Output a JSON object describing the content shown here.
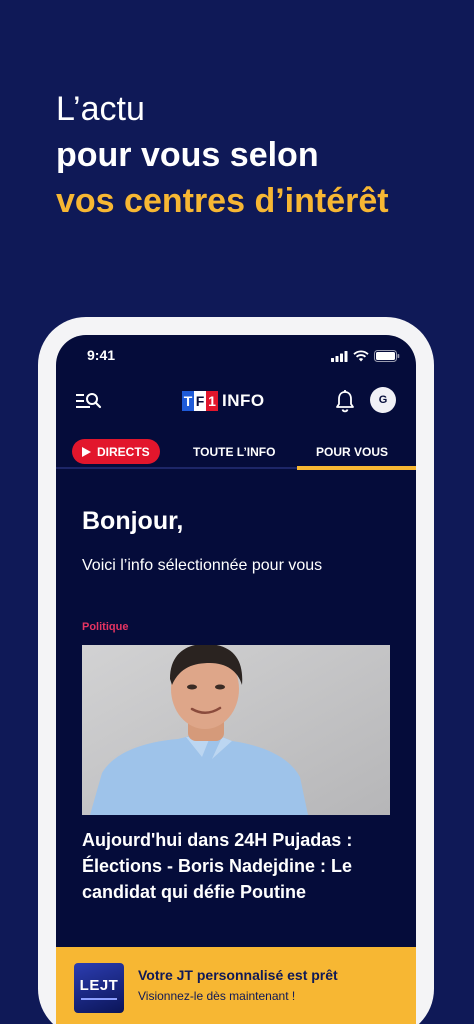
{
  "promo": {
    "line1": "L’actu",
    "line2": "pour vous selon",
    "line3": "vos centres d’intérêt"
  },
  "status_bar": {
    "time": "9:41"
  },
  "app_bar": {
    "logo_letters": [
      "T",
      "F",
      "1"
    ],
    "logo_text": "INFO",
    "avatar_initial": "G",
    "icons": [
      "menu-search-icon",
      "bell-icon"
    ]
  },
  "tabs": {
    "directs": "DIRECTS",
    "toute": "TOUTE L’INFO",
    "pour_vous": "POUR VOUS",
    "active": "POUR VOUS"
  },
  "feed": {
    "greeting": "Bonjour,",
    "subtitle": "Voici l’info sélectionnée pour vous",
    "article": {
      "category": "Politique",
      "title": "Aujourd'hui dans 24H Pujadas : Élections - Boris Nadejdine : Le candidat qui défie Poutine"
    }
  },
  "banner": {
    "thumb_text": "LEJT",
    "title": "Votre JT personnalisé est prêt",
    "subtitle": "Visionnez-le dès maintenant !"
  },
  "colors": {
    "background": "#0f1957",
    "screen": "#050c3a",
    "accent_yellow": "#f7b733",
    "live_red": "#e2162c",
    "category_pink": "#e63462"
  }
}
